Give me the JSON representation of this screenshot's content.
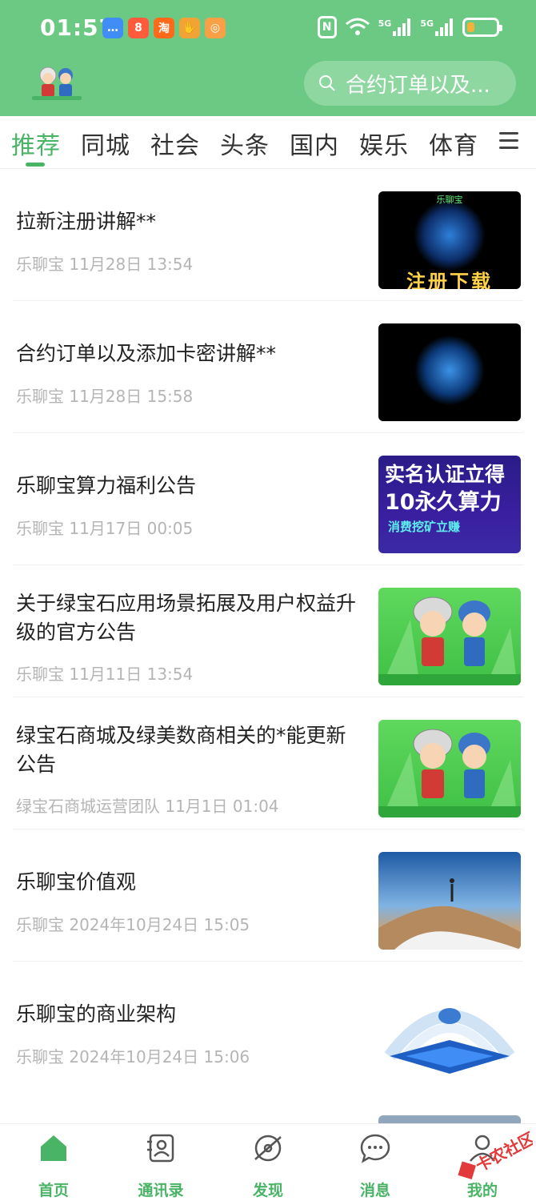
{
  "status_bar": {
    "time": "01:57",
    "app_badges": [
      {
        "icon": "message-icon",
        "glyph": "…",
        "color": "#3f8df5"
      },
      {
        "icon": "baidu-icon",
        "glyph": "8",
        "color": "#ff5a3c"
      },
      {
        "icon": "taobao-icon",
        "glyph": "淘",
        "color": "#ff6a1a"
      },
      {
        "icon": "hand-icon",
        "glyph": "✋",
        "color": "#f2a336"
      },
      {
        "icon": "clock-app-icon",
        "glyph": "◎",
        "color": "#f7a046"
      }
    ],
    "signal_1": "5G",
    "signal_2": "5G",
    "battery_level": 0.25
  },
  "header": {
    "search_placeholder": "合约订单以及..."
  },
  "tabs": {
    "items": [
      "推荐",
      "同城",
      "社会",
      "头条",
      "国内",
      "娱乐",
      "体育"
    ],
    "active": "推荐"
  },
  "feed": [
    {
      "title": "拉新注册讲解**",
      "meta": "乐聊宝 11月28日 13:54",
      "thumb_top": "乐聊宝",
      "thumb_bottom": "注册下载"
    },
    {
      "title": "合约订单以及添加卡密讲解**",
      "meta": "乐聊宝 11月28日 15:58"
    },
    {
      "title": "乐聊宝算力福利公告",
      "meta": "乐聊宝 11月17日 00:05",
      "thumb_l1": "实名认证立得",
      "thumb_l2": "10永久算力",
      "thumb_l3": "消费挖矿立赚"
    },
    {
      "title": "关于绿宝石应用场景拓展及用户权益升级的官方公告",
      "meta": "乐聊宝 11月11日 13:54"
    },
    {
      "title": "绿宝石商城及绿美数商相关的*能更新公告",
      "meta": "绿宝石商城运营团队 11月1日 01:04"
    },
    {
      "title": "乐聊宝价值观",
      "meta": "乐聊宝 2024年10月24日 15:05"
    },
    {
      "title": "乐聊宝的商业架构",
      "meta": "乐聊宝 2024年10月24日 15:06"
    }
  ],
  "bottom_nav": [
    {
      "label": "首页",
      "icon": "home-icon"
    },
    {
      "label": "通讯录",
      "icon": "contacts-icon"
    },
    {
      "label": "发现",
      "icon": "discover-icon"
    },
    {
      "label": "消息",
      "icon": "message-bubble-icon"
    },
    {
      "label": "我的",
      "icon": "profile-icon"
    }
  ],
  "watermark": "卡农社区",
  "colors": {
    "header_green": "#6cc983",
    "accent_green": "#4ab466",
    "meta_gray": "#b5b5b5"
  }
}
